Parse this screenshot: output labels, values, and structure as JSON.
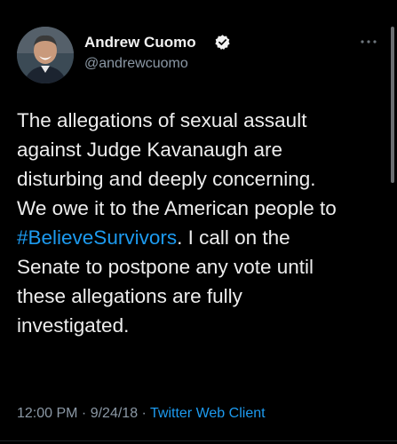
{
  "author": {
    "display_name": "Andrew Cuomo",
    "handle": "@andrewcuomo",
    "verified": true
  },
  "tweet": {
    "lines": [
      "The allegations of sexual assault",
      "against Judge Kavanaugh are",
      "disturbing and deeply concerning.",
      "We owe it to the American people to"
    ],
    "hashtag": "#BelieveSurvivors",
    "hashtag_line_rest": ". I call on the",
    "lines_after": [
      "Senate to postpone any vote until",
      "these allegations are fully",
      "investigated."
    ]
  },
  "meta": {
    "time": "12:00 PM",
    "separator": " · ",
    "date": "9/24/18",
    "client": "Twitter Web Client"
  },
  "icons": {
    "avatar": "profile-photo",
    "verified": "verified-badge-icon",
    "more": "more-options-icon"
  },
  "colors": {
    "background": "#000000",
    "text": "#e7e9ea",
    "secondary": "#8b98a5",
    "link": "#1d9bf0"
  }
}
